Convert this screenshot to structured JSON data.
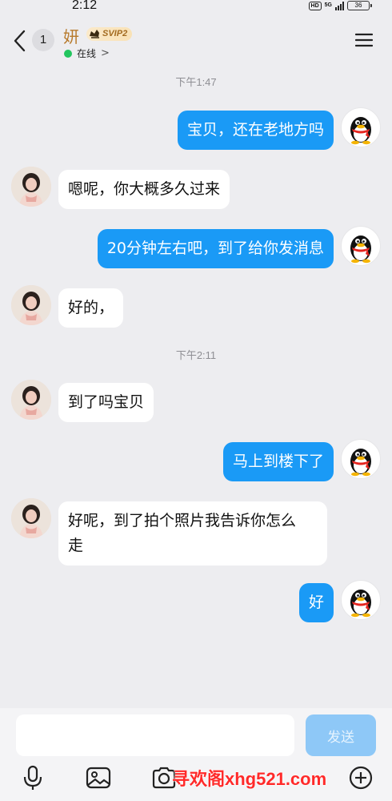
{
  "status": {
    "time": "2:12",
    "hd": "HD",
    "network": "5G",
    "battery": "36"
  },
  "header": {
    "back_count": "1",
    "contact_name": "妍",
    "vip_label": "SVIP2",
    "presence": "在线",
    "presence_arrow": ">"
  },
  "messages": [
    {
      "type": "time",
      "text": "下午1:47"
    },
    {
      "type": "out",
      "text": "宝贝，还在老地方吗"
    },
    {
      "type": "in",
      "text": "嗯呢，你大概多久过来"
    },
    {
      "type": "out",
      "text": "20分钟左右吧，到了给你发消息"
    },
    {
      "type": "in",
      "text": "好的，"
    },
    {
      "type": "time",
      "text": "下午2:11"
    },
    {
      "type": "in",
      "text": "到了吗宝贝"
    },
    {
      "type": "out",
      "text": "马上到楼下了"
    },
    {
      "type": "in",
      "text": "好呢，到了拍个照片我告诉你怎么\n走"
    },
    {
      "type": "out",
      "text": "好"
    }
  ],
  "composer": {
    "input_value": "",
    "send_label": "发送"
  },
  "toolbar": {
    "icons": [
      "mic-icon",
      "image-icon",
      "camera-icon",
      "plus-icon"
    ]
  },
  "watermark": "寻欢阁xhg521.com",
  "colors": {
    "outgoing_bubble": "#1a9af6",
    "incoming_bubble": "#ffffff",
    "background": "#ededf0",
    "online_dot": "#22c55e",
    "send_disabled": "#8ec8f7"
  }
}
